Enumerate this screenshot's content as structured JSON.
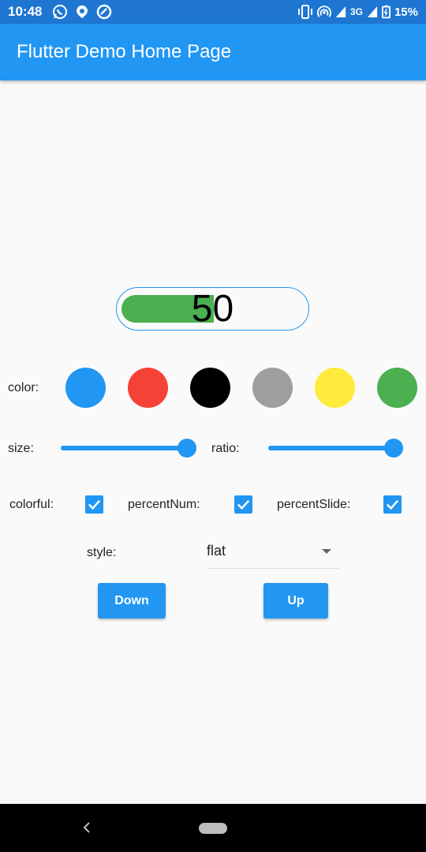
{
  "status_bar": {
    "time": "10:48",
    "left_icons": [
      "whatsapp-icon",
      "location-icon",
      "data-saver-icon"
    ],
    "right_icons": [
      "vibrate-icon",
      "hotspot-icon",
      "signal-icon",
      "battery-icon"
    ],
    "network": "3G",
    "battery": "15%",
    "background": "#1e76d2"
  },
  "app_bar": {
    "title": "Flutter Demo Home Page",
    "background": "#2196f3"
  },
  "progress": {
    "value": "50",
    "fill_fraction": 0.5,
    "fill_color": "#4caf50",
    "border_color": "#2196f3"
  },
  "color_row": {
    "label": "color:",
    "options": [
      "#2196f3",
      "#f44336",
      "#000000",
      "#9e9e9e",
      "#ffeb3b",
      "#4caf50"
    ]
  },
  "sliders": {
    "size_label": "size:",
    "size_fraction": 1.0,
    "ratio_label": "ratio:",
    "ratio_fraction": 1.0
  },
  "checkboxes": {
    "colorful_label": "colorful:",
    "colorful_checked": true,
    "percent_num_label": "percentNum:",
    "percent_num_checked": true,
    "percent_slide_label": "percentSlide:",
    "percent_slide_checked": true
  },
  "style_select": {
    "label": "style:",
    "value": "flat"
  },
  "buttons": {
    "down_label": "Down",
    "up_label": "Up"
  }
}
